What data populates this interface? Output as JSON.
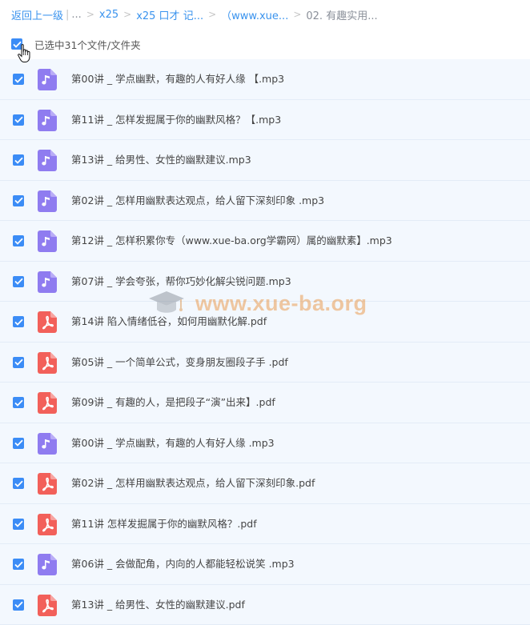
{
  "breadcrumb": {
    "back": "返回上一级",
    "ellipsis": "...",
    "items": [
      "x25",
      "x25 口才 记...",
      "（www.xue...",
      "02. 有趣实用..."
    ]
  },
  "select_all": {
    "label": "已选中31个文件/文件夹",
    "checked": true
  },
  "files": [
    {
      "name": "第00讲 _ 学点幽默，有趣的人有好人缘 【.mp3",
      "type": "audio"
    },
    {
      "name": "第11讲 _ 怎样发掘属于你的幽默风格？【.mp3",
      "type": "audio"
    },
    {
      "name": "第13讲 _ 给男性、女性的幽默建议.mp3",
      "type": "audio"
    },
    {
      "name": "第02讲 _ 怎样用幽默表达观点，给人留下深刻印象 .mp3",
      "type": "audio"
    },
    {
      "name": "第12讲 _ 怎样积累你专（www.xue-ba.org学霸网）属的幽默素】.mp3",
      "type": "audio"
    },
    {
      "name": "第07讲 _ 学会夸张，帮你巧妙化解尖锐问题.mp3",
      "type": "audio"
    },
    {
      "name": "第14讲 陷入情绪低谷，如何用幽默化解.pdf",
      "type": "pdf"
    },
    {
      "name": "第05讲 _ 一个简单公式，变身朋友圈段子手 .pdf",
      "type": "pdf"
    },
    {
      "name": "第09讲 _ 有趣的人，是把段子“演”出来】.pdf",
      "type": "pdf"
    },
    {
      "name": "第00讲 _ 学点幽默，有趣的人有好人缘 .mp3",
      "type": "audio"
    },
    {
      "name": "第02讲 _ 怎样用幽默表达观点，给人留下深刻印象.pdf",
      "type": "pdf"
    },
    {
      "name": "第11讲 怎样发掘属于你的幽默风格？.pdf",
      "type": "pdf"
    },
    {
      "name": "第06讲 _ 会做配角，内向的人都能轻松说笑 .mp3",
      "type": "audio"
    },
    {
      "name": "第13讲 _ 给男性、女性的幽默建议.pdf",
      "type": "pdf"
    }
  ],
  "watermark": {
    "text": "www.xue-ba.org",
    "icon": "graduation-cap-icon"
  },
  "colors": {
    "link": "#3a93ee",
    "checkbox": "#3b8cf6",
    "row_bg": "#f3f8fe",
    "audio_icon": "#8f7cf0",
    "pdf_icon": "#f2605a"
  }
}
